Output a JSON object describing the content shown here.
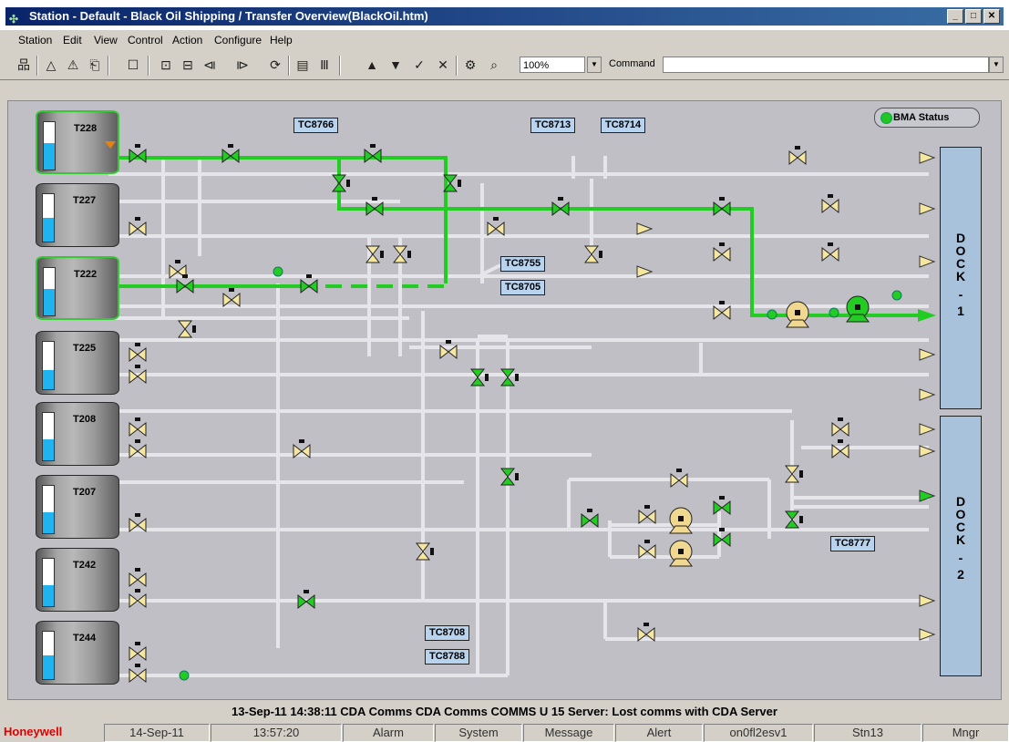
{
  "window": {
    "title": "Station - Default - Black Oil Shipping / Transfer Overview(BlackOil.htm)"
  },
  "menu": [
    "Station",
    "Edit",
    "View",
    "Control",
    "Action",
    "Configure",
    "Help"
  ],
  "toolbar": {
    "zoom": "100%",
    "command_label": "Command",
    "command_value": ""
  },
  "tanks": [
    {
      "name": "T228",
      "level": 0.55,
      "highlighted": true
    },
    {
      "name": "T227",
      "level": 0.5,
      "highlighted": false
    },
    {
      "name": "T222",
      "level": 0.55,
      "highlighted": true
    },
    {
      "name": "T225",
      "level": 0.4,
      "highlighted": false
    },
    {
      "name": "T208",
      "level": 0.45,
      "highlighted": false
    },
    {
      "name": "T207",
      "level": 0.45,
      "highlighted": false
    },
    {
      "name": "T242",
      "level": 0.45,
      "highlighted": false
    },
    {
      "name": "T244",
      "level": 0.5,
      "highlighted": false
    }
  ],
  "tags": [
    "TC8766",
    "TC8713",
    "TC8714",
    "TC8755",
    "TC8705",
    "TC8777",
    "TC8708",
    "TC8788"
  ],
  "docks": [
    {
      "letters": [
        "D",
        "O",
        "C",
        "K",
        "-",
        "1"
      ]
    },
    {
      "letters": [
        "D",
        "O",
        "C",
        "K",
        "-",
        "2"
      ]
    }
  ],
  "bma_status": "BMA Status",
  "colors": {
    "active_line": "#22cc22",
    "idle_line": "#e6e6ea",
    "valve_idle": "#f5e6a0",
    "valve_open": "#22cc22",
    "pump_idle": "#f0d890",
    "dock": "#a9c2dc",
    "tag_bg": "#b8d3ee"
  },
  "alarm_line": "13-Sep-11  14:38:11  CDA Comms  CDA Comms   COMMS   U 15 Server: Lost comms with CDA Server",
  "status": {
    "brand": "Honeywell",
    "date": "14-Sep-11",
    "time": "13:57:20",
    "alarm": "Alarm",
    "system": "System",
    "message": "Message",
    "alert": "Alert",
    "server": "on0fl2esv1",
    "station": "Stn13",
    "user": "Mngr"
  }
}
